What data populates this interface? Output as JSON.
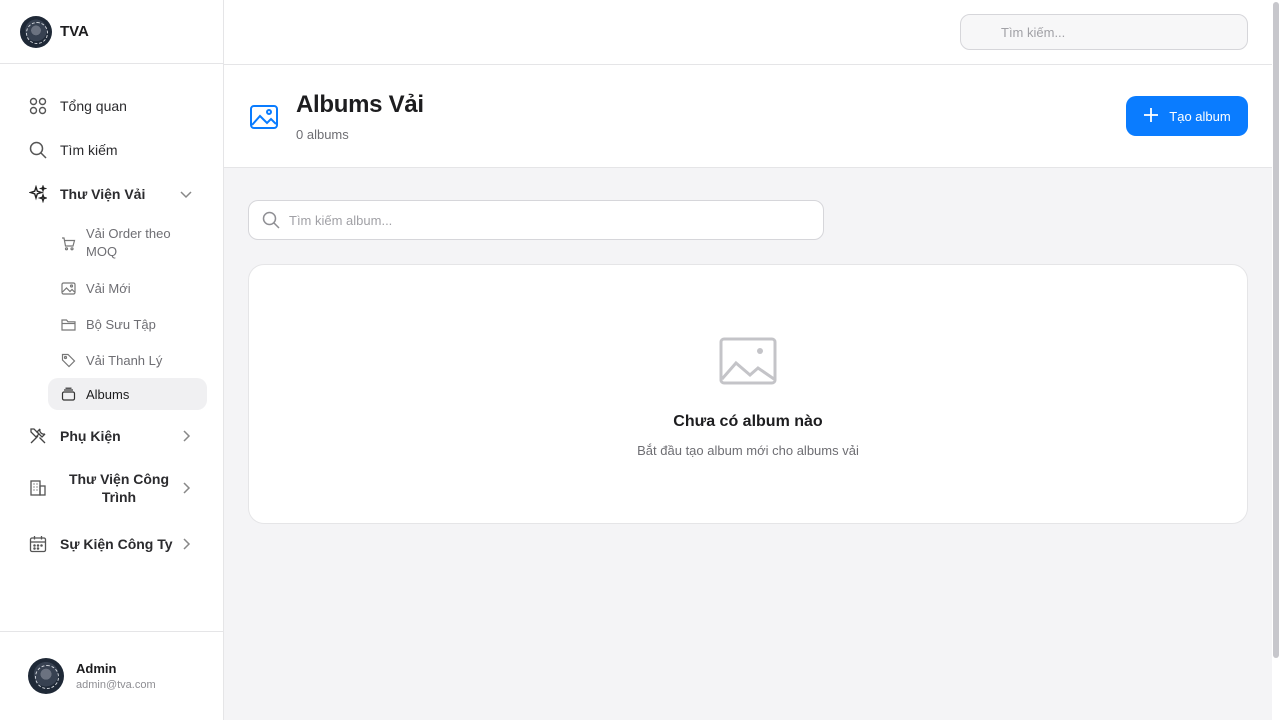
{
  "brand": {
    "name": "TVA",
    "logo_icon": "company-logo"
  },
  "sidebar": {
    "items": [
      {
        "label": "Tổng quan",
        "icon": "grid-icon"
      },
      {
        "label": "Tìm kiếm",
        "icon": "search-icon"
      },
      {
        "label": "Thư Viện Vải",
        "icon": "sparkles-icon",
        "expanded": true,
        "children": [
          {
            "label": "Vải Order theo MOQ",
            "icon": "cart-icon"
          },
          {
            "label": "Vải Mới",
            "icon": "image-icon"
          },
          {
            "label": "Bộ Sưu Tập",
            "icon": "folder-icon"
          },
          {
            "label": "Vải Thanh Lý",
            "icon": "tag-icon"
          },
          {
            "label": "Albums",
            "icon": "albums-icon",
            "active": true
          }
        ]
      },
      {
        "label": "Phụ Kiện",
        "icon": "tools-icon"
      },
      {
        "label": "Thư Viện Công Trình",
        "icon": "building-icon"
      },
      {
        "label": "Sự Kiện Công Ty",
        "icon": "calendar-icon"
      }
    ]
  },
  "user": {
    "name": "Admin",
    "email": "admin@tva.com"
  },
  "topbar": {
    "search_placeholder": "Tìm kiếm..."
  },
  "header": {
    "title": "Albums Vải",
    "count": "0 albums",
    "create_label": "Tạo album"
  },
  "content": {
    "search_placeholder": "Tìm kiếm album...",
    "empty_title": "Chưa có album nào",
    "empty_subtitle": "Bắt đầu tạo album mới cho albums vải"
  },
  "colors": {
    "accent": "#0a7cff",
    "background": "#f4f4f6"
  }
}
